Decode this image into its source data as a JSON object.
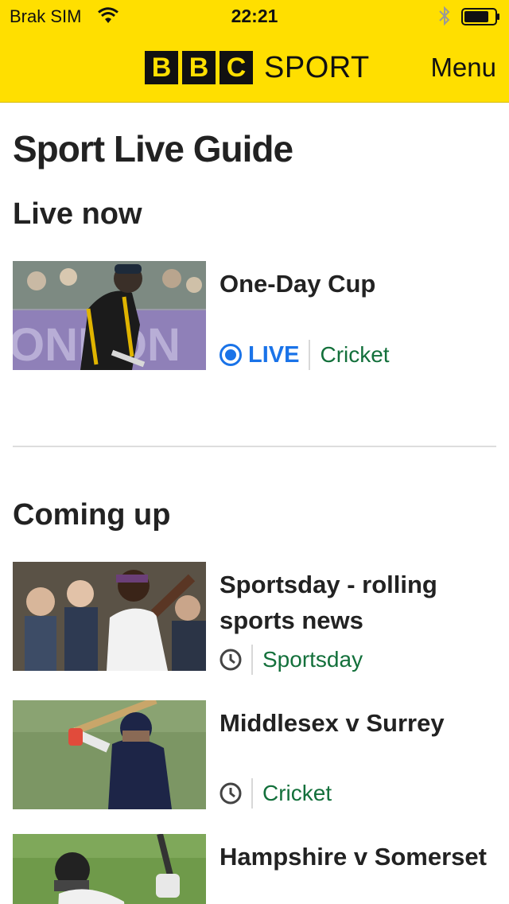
{
  "status_bar": {
    "carrier": "Brak SIM",
    "time": "22:21"
  },
  "header": {
    "logo_letters": [
      "B",
      "B",
      "C"
    ],
    "logo_sport": "SPORT",
    "menu_label": "Menu",
    "brand_color": "#ffdf00"
  },
  "page_title": "Sport Live Guide",
  "live_now": {
    "heading": "Live now",
    "items": [
      {
        "title": "One-Day Cup",
        "status": "LIVE",
        "tag": "Cricket",
        "image": "cricket-batsman-yellow-kit"
      }
    ]
  },
  "coming_up": {
    "heading": "Coming up",
    "items": [
      {
        "title": "Sportsday - rolling sports news",
        "tag": "Sportsday",
        "icon": "clock-icon",
        "image": "crowd-man-waving"
      },
      {
        "title": "Middlesex v Surrey",
        "tag": "Cricket",
        "icon": "clock-icon",
        "image": "cricket-batsman-navy-kit"
      },
      {
        "title": "Hampshire v Somerset",
        "tag": "",
        "icon": "clock-icon",
        "image": "cricket-batsman-helmet"
      }
    ]
  },
  "colors": {
    "live_blue": "#1a73e8",
    "tag_green": "#13703b",
    "text": "#222222"
  }
}
